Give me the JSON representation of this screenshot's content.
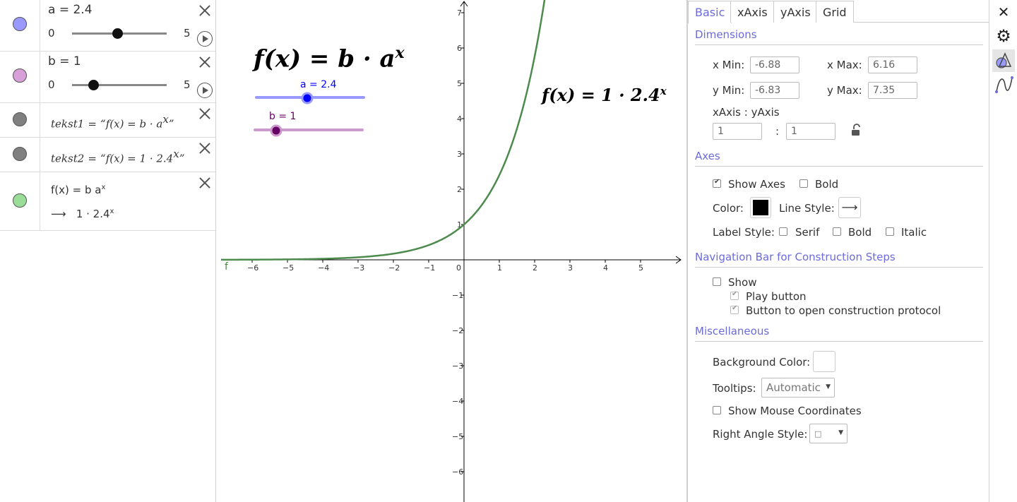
{
  "algebra": {
    "rows": [
      {
        "type": "slider",
        "label": "a = 2.4",
        "min": "0",
        "max": "5",
        "value": 2.4,
        "range": [
          0,
          5
        ],
        "color": "#9999ff"
      },
      {
        "type": "slider",
        "label": "b = 1",
        "min": "0",
        "max": "5",
        "value": 1,
        "range": [
          0,
          5
        ],
        "color": "#d8a0d8"
      },
      {
        "type": "text",
        "name": "tekst1",
        "eq": "=",
        "value": "“f(x) = b · a",
        "sup": "x",
        "close": "”",
        "color": "#808080"
      },
      {
        "type": "text",
        "name": "tekst2",
        "eq": "=",
        "value": "“f(x) = 1 · 2.4",
        "sup": "x",
        "close": "”",
        "color": "#808080"
      },
      {
        "type": "function",
        "def": "f(x) = b a",
        "def_sup": "x",
        "arrow": "⟶",
        "result": "1 · 2.4",
        "result_sup": "x",
        "color": "#99dd99"
      }
    ]
  },
  "graphics": {
    "formula_main": "f(x) = b · a",
    "formula_main_sup": "x",
    "formula_result": "f(x) = 1 · 2.4",
    "formula_result_sup": "x",
    "slider_a": {
      "label": "a = 2.4",
      "value": 2.4,
      "range": [
        0,
        5
      ],
      "color": "#0000ff",
      "track_color": "#9999ff"
    },
    "slider_b": {
      "label": "b = 1",
      "value": 1,
      "range": [
        0,
        5
      ],
      "color": "#660066",
      "track_color": "#cc99cc"
    },
    "function_label": "f",
    "curve_color": "#4d8b4d"
  },
  "chart_data": {
    "type": "line",
    "function": "f(x) = 1 · 2.4^x",
    "xlim": [
      -6.88,
      6.16
    ],
    "ylim": [
      -6.83,
      7.35
    ],
    "x_ticks": [
      "−6",
      "−5",
      "−4",
      "−3",
      "−2",
      "−1",
      "0",
      "1",
      "2",
      "3",
      "4",
      "5"
    ],
    "y_ticks": [
      "7",
      "6",
      "5",
      "4",
      "3",
      "2",
      "1",
      "−1",
      "−2",
      "−3",
      "−4",
      "−5",
      "−6"
    ],
    "series": [
      {
        "name": "f",
        "base": 2.4,
        "coef": 1
      }
    ]
  },
  "properties": {
    "tabs": [
      "Basic",
      "xAxis",
      "yAxis",
      "Grid"
    ],
    "active_tab": "Basic",
    "dimensions": {
      "title": "Dimensions",
      "xmin_label": "x Min:",
      "xmin": "-6.88",
      "xmax_label": "x Max:",
      "xmax": "6.16",
      "ymin_label": "y Min:",
      "ymin": "-6.83",
      "ymax_label": "y Max:",
      "ymax": "7.35",
      "ratio_label": "xAxis : yAxis",
      "ratio_x": "1",
      "ratio_sep": ":",
      "ratio_y": "1"
    },
    "axes": {
      "title": "Axes",
      "show_axes": "Show Axes",
      "bold": "Bold",
      "color_label": "Color:",
      "line_style_label": "Line Style:",
      "line_style_value": "⟶",
      "label_style": "Label Style:",
      "serif": "Serif",
      "bold2": "Bold",
      "italic": "Italic",
      "axis_color": "#000000"
    },
    "navbar": {
      "title": "Navigation Bar for Construction Steps",
      "show": "Show",
      "play": "Play button",
      "protocol": "Button to open construction protocol"
    },
    "misc": {
      "title": "Miscellaneous",
      "bg_label": "Background Color:",
      "tooltips_label": "Tooltips:",
      "tooltips_value": "Automatic",
      "mouse_coords": "Show Mouse Coordinates",
      "right_angle_label": "Right Angle Style:",
      "right_angle_value": "□"
    }
  },
  "toolbar": {
    "close": "✕",
    "settings": "⚙"
  }
}
